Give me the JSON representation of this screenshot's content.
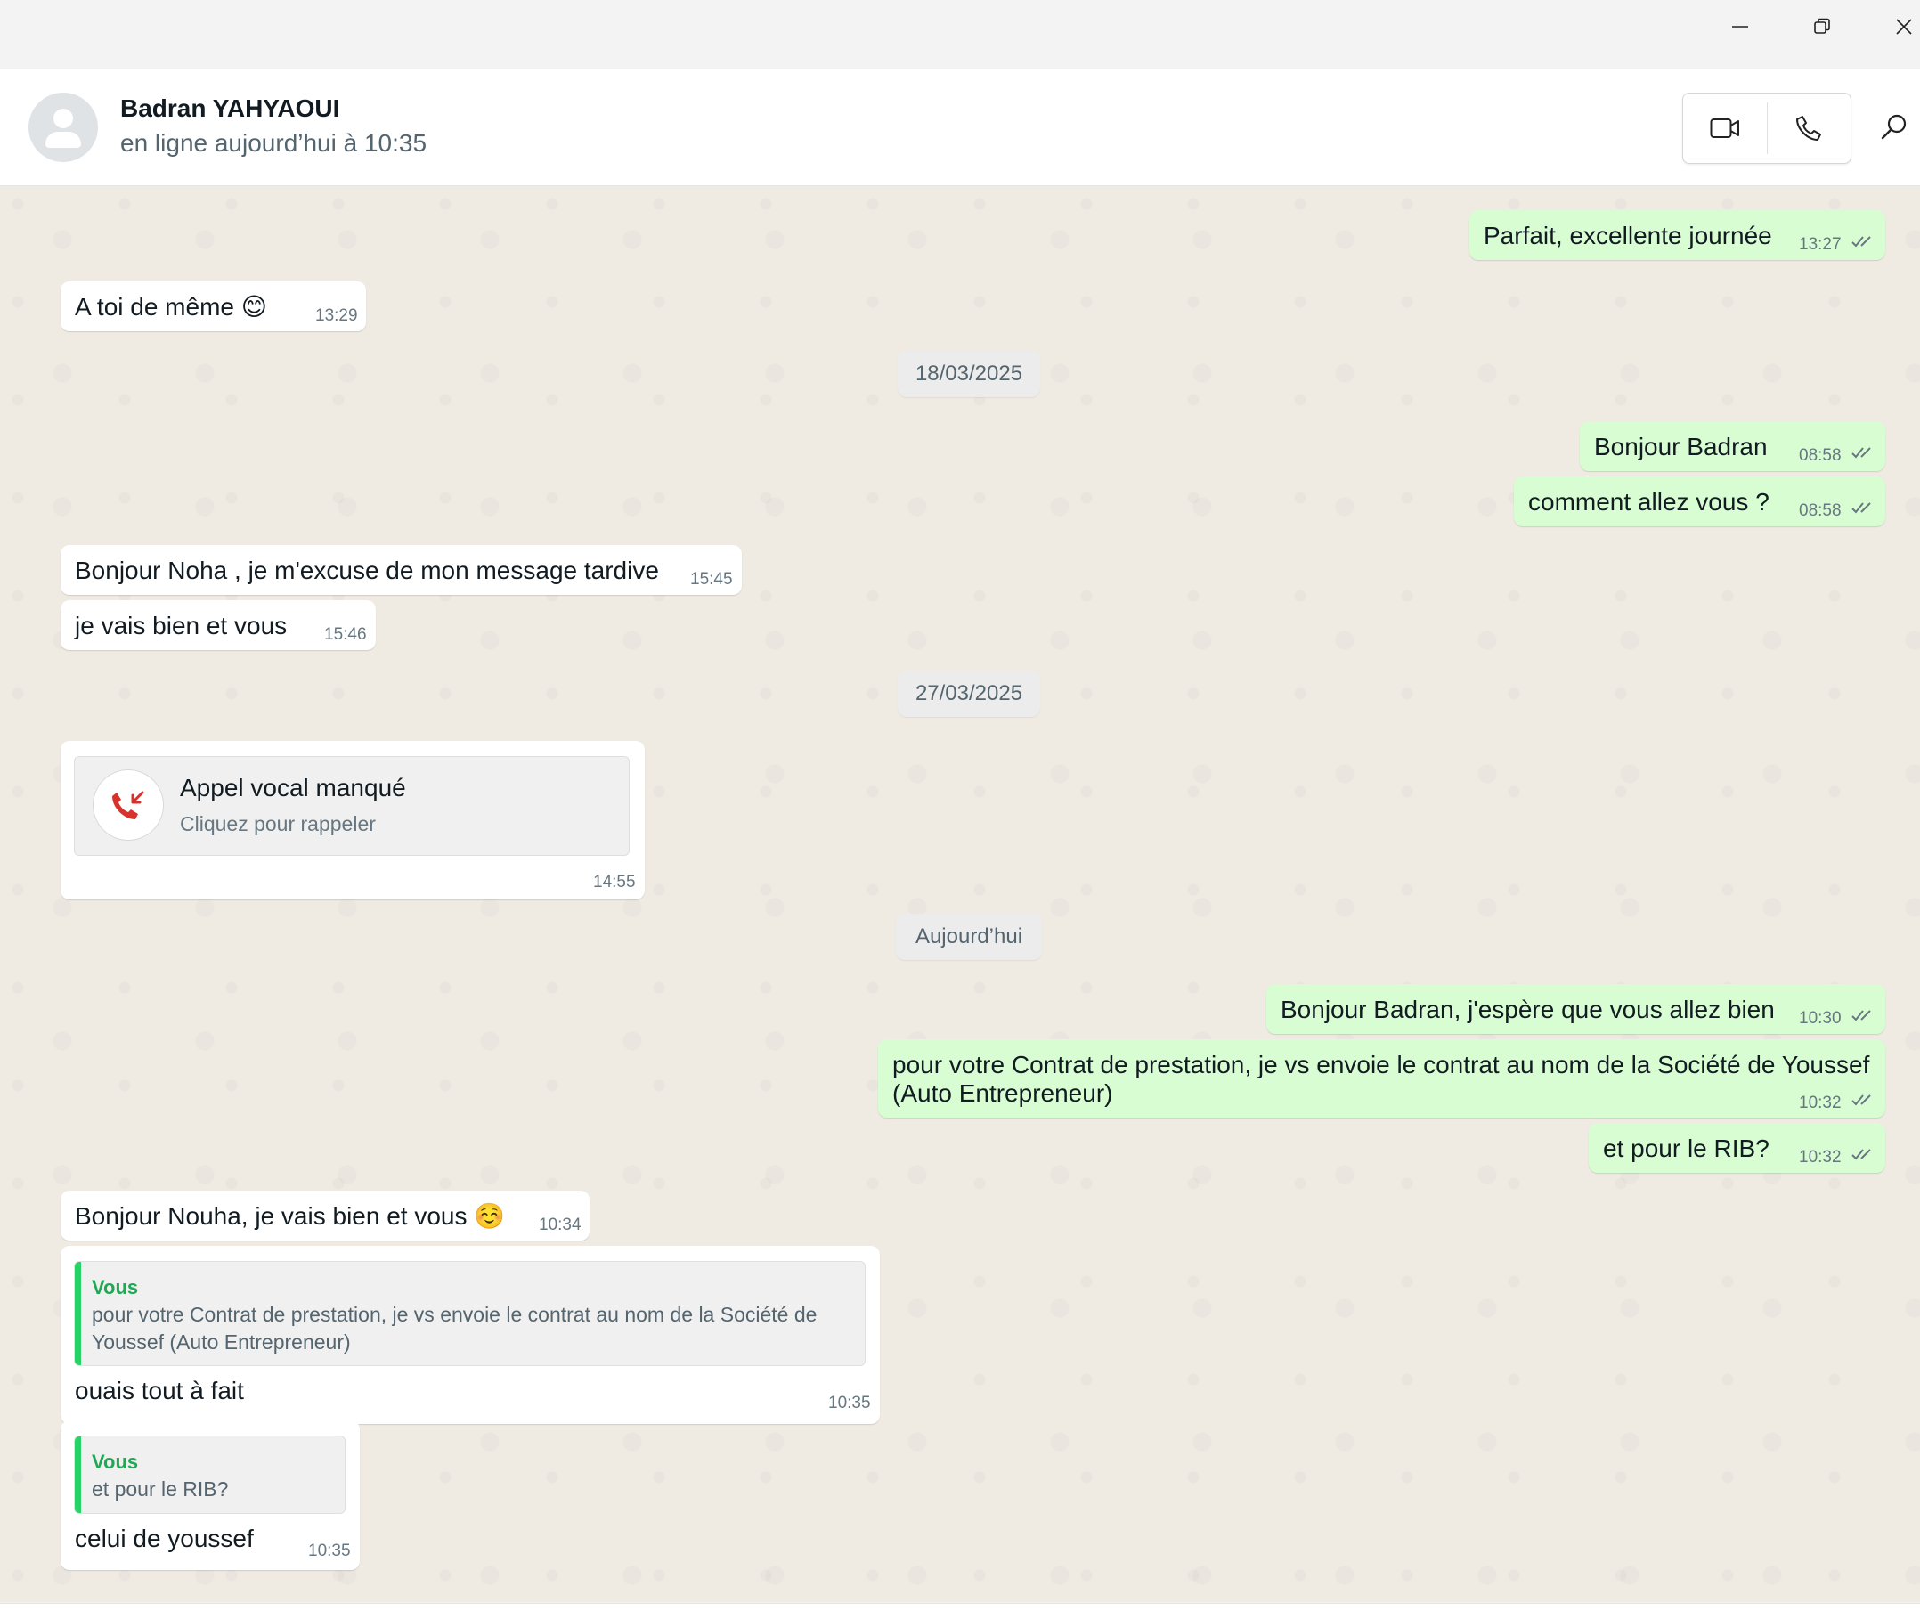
{
  "window": {
    "minimize_icon": "minimize-icon",
    "maximize_icon": "restore-icon",
    "close_icon": "close-icon"
  },
  "header": {
    "contact_name": "Badran YAHYAOUI",
    "status": "en ligne aujourd’hui à 10:35",
    "video_icon": "video-camera-icon",
    "call_icon": "phone-icon",
    "search_icon": "search-icon"
  },
  "colors": {
    "incoming_bubble": "#ffffff",
    "outgoing_bubble": "#d9fdd3",
    "quote_accent": "#25d366",
    "missed_call": "#d9312b",
    "read_ticks": "#667781"
  },
  "messages": [
    {
      "dir": "out",
      "text": "Parfait, excellente journée",
      "time": "13:27"
    },
    {
      "dir": "in",
      "text": "A toi de même 😊",
      "time": "13:29"
    },
    {
      "date": "18/03/2025"
    },
    {
      "dir": "out",
      "text": "Bonjour Badran",
      "time": "08:58"
    },
    {
      "dir": "out",
      "text": "comment allez vous ?",
      "time": "08:58"
    },
    {
      "dir": "in",
      "text": "Bonjour Noha , je m'excuse de mon message tardive",
      "time": "15:45"
    },
    {
      "dir": "in",
      "text": "je vais bien et vous",
      "time": "15:46"
    },
    {
      "date": "27/03/2025"
    },
    {
      "dir": "in",
      "missed_call": {
        "title": "Appel vocal manqué",
        "subtitle": "Cliquez pour rappeler"
      },
      "time": "14:55"
    },
    {
      "date": "Aujourd’hui"
    },
    {
      "dir": "out",
      "text": "Bonjour Badran, j'espère que vous allez bien",
      "time": "10:30"
    },
    {
      "dir": "out",
      "text_line1": "pour votre Contrat de prestation, je vs envoie le contrat au nom de la Société de Youssef",
      "text_line2": "(Auto Entrepreneur)",
      "time": "10:32"
    },
    {
      "dir": "out",
      "text": "et pour le RIB?",
      "time": "10:32"
    },
    {
      "dir": "in",
      "text": "Bonjour Nouha, je vais bien et vous ☺️",
      "time": "10:34"
    },
    {
      "dir": "in",
      "quote": {
        "author": "Vous",
        "line1": "pour votre Contrat de prestation, je vs envoie le contrat au nom de la Société de",
        "line2": "Youssef  (Auto Entrepreneur)"
      },
      "text": "ouais tout à fait",
      "time": "10:35"
    },
    {
      "dir": "in",
      "quote": {
        "author": "Vous",
        "line1": "et pour le RIB?"
      },
      "text": "celui de youssef",
      "time": "10:35"
    }
  ]
}
